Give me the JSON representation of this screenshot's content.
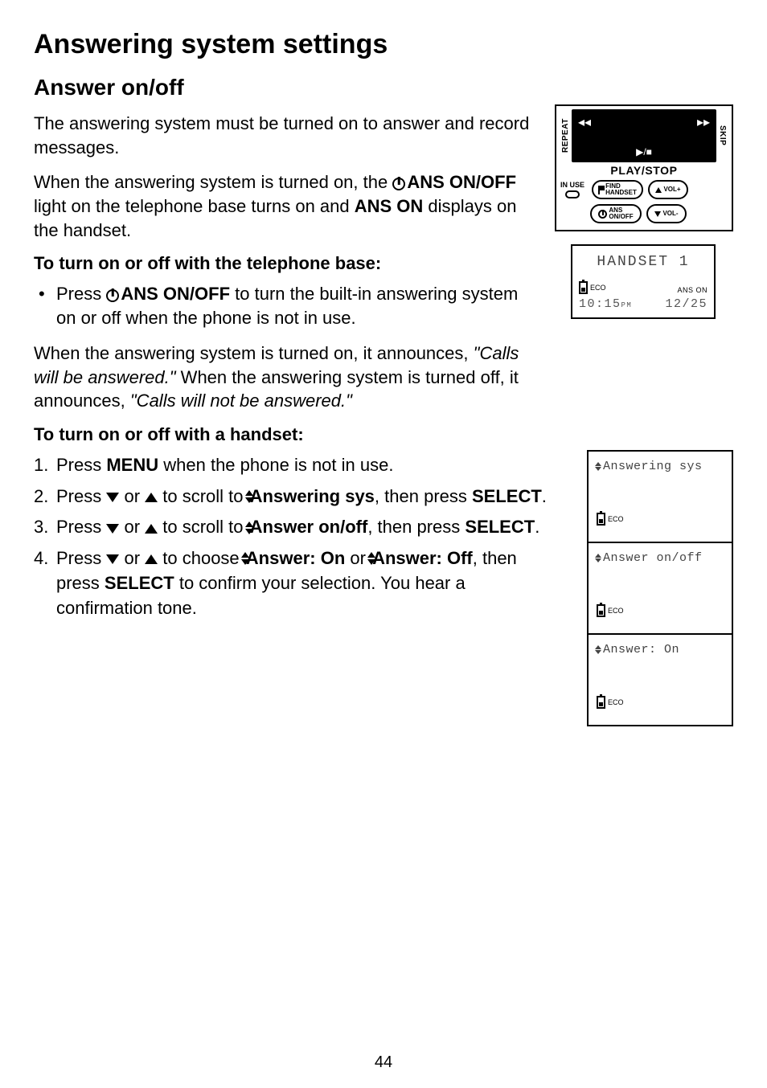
{
  "title": "Answering system settings",
  "section": "Answer on/off",
  "p1": "The answering system must be turned on to answer and record messages.",
  "p2a": "When the answering system is turned on, the ",
  "p2b": "ANS ON/OFF",
  "p2c": " light on the telephone base turns on and ",
  "p2d": "ANS ON",
  "p2e": " displays on the handset.",
  "sub1": "To turn on or off with the telephone base:",
  "bullet1a": "Press ",
  "bullet1b": "ANS ON/OFF",
  "bullet1c": " to turn the built-in answering system on or off when the phone is not in use.",
  "p3a": "When the answering system is turned on, it announces, ",
  "p3b": "\"Calls will be answered.\"",
  "p3c": "  When the answering system is turned off, it announces, ",
  "p3d": "\"Calls will not be answered.\"",
  "sub2": "To turn on or off with a handset:",
  "step1a": "Press ",
  "step1b": "MENU",
  "step1c": " when the phone is not in use.",
  "step2a": "Press ",
  "step2b": " or ",
  "step2c": " to scroll to ",
  "step2d": "Answering sys",
  "step2e": ", then press ",
  "step2f": "SELECT",
  "step2g": ".",
  "step3a": "Press ",
  "step3b": " or ",
  "step3c": " to scroll to ",
  "step3d": "Answer on/off",
  "step3e": ", then press ",
  "step3f": "SELECT",
  "step3g": ".",
  "step4a": "Press ",
  "step4b": " or ",
  "step4c": " to choose ",
  "step4d": "Answer: On",
  "step4e": " or ",
  "step4f": "Answer: Off",
  "step4g": ", then press ",
  "step4h": "SELECT",
  "step4i": " to confirm your selection. You hear a confirmation tone.",
  "page_number": "44",
  "base": {
    "repeat": "REPEAT",
    "skip": "SKIP",
    "playstop_label": "PLAY/STOP",
    "playstop_icon": "▶/■",
    "in_use": "IN USE",
    "find_handset": "FIND HANDSET",
    "vol_plus": "VOL+",
    "ans_onoff": "ANS ON/OFF",
    "vol_minus": "VOL-"
  },
  "lcd_main": {
    "title": "HANDSET 1",
    "eco": "ECO",
    "ans_on": "ANS ON",
    "time": "10:15",
    "ampm": "PM",
    "date": "12/25"
  },
  "lcd1": {
    "line": "Answering sys",
    "eco": "ECO"
  },
  "lcd2": {
    "line": "Answer on/off",
    "eco": "ECO"
  },
  "lcd3": {
    "line": "Answer: On",
    "eco": "ECO"
  }
}
